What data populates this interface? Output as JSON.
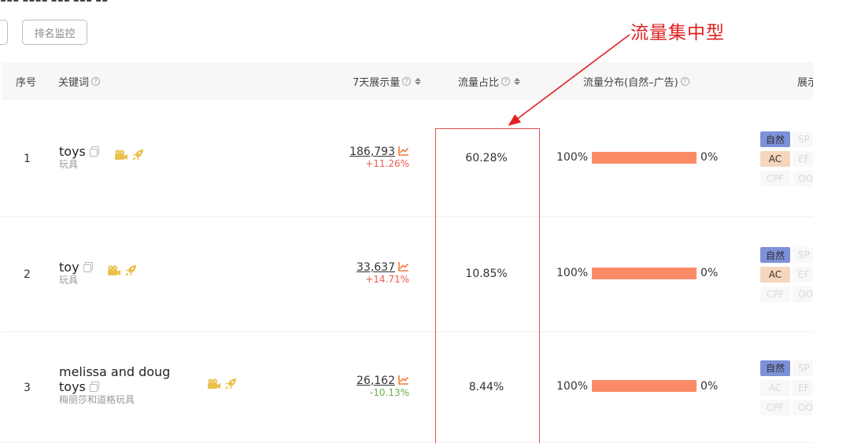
{
  "toolbar": {
    "rank_monitor_label": "排名监控"
  },
  "table": {
    "headers": {
      "index": "序号",
      "keyword": "关键词",
      "impressions_7d": "7天展示量",
      "traffic_share": "流量占比",
      "traffic_distribution": "流量分布(自然–广告)",
      "display": "展示"
    },
    "rows": [
      {
        "index": "1",
        "keyword_line1": "toys",
        "keyword_line2": "",
        "keyword_cn": "玩具",
        "impressions": "186,793",
        "change": "+11.26%",
        "change_dir": "up",
        "share": "60.28%",
        "natural_pct": "100%",
        "ad_pct": "0%",
        "natural_fraction": 1.0,
        "tags": [
          {
            "label": "自然",
            "state": "blue"
          },
          {
            "label": "SP",
            "state": "off"
          },
          {
            "label": "AC",
            "state": "orange"
          },
          {
            "label": "EF",
            "state": "off"
          },
          {
            "label": "CPF",
            "state": "off"
          },
          {
            "label": "OO",
            "state": "off"
          }
        ]
      },
      {
        "index": "2",
        "keyword_line1": "toy",
        "keyword_line2": "",
        "keyword_cn": "玩具",
        "impressions": "33,637",
        "change": "+14.71%",
        "change_dir": "up",
        "share": "10.85%",
        "natural_pct": "100%",
        "ad_pct": "0%",
        "natural_fraction": 1.0,
        "tags": [
          {
            "label": "自然",
            "state": "blue"
          },
          {
            "label": "SP",
            "state": "off"
          },
          {
            "label": "AC",
            "state": "orange"
          },
          {
            "label": "EF",
            "state": "off"
          },
          {
            "label": "CPF",
            "state": "off"
          },
          {
            "label": "OO",
            "state": "off"
          }
        ]
      },
      {
        "index": "3",
        "keyword_line1": "melissa and doug",
        "keyword_line2": "toys",
        "keyword_cn": "梅丽莎和道格玩具",
        "impressions": "26,162",
        "change": "-10.13%",
        "change_dir": "down",
        "share": "8.44%",
        "natural_pct": "100%",
        "ad_pct": "0%",
        "natural_fraction": 1.0,
        "tags": [
          {
            "label": "自然",
            "state": "blue"
          },
          {
            "label": "SP",
            "state": "off"
          },
          {
            "label": "AC",
            "state": "off"
          },
          {
            "label": "EF",
            "state": "off"
          },
          {
            "label": "CPF",
            "state": "off"
          },
          {
            "label": "OO",
            "state": "off"
          }
        ]
      }
    ]
  },
  "annotation": {
    "label": "流量集中型",
    "color": "#e02020"
  },
  "colors": {
    "bar_natural": "#fb8b66",
    "tag_blue": "#7e91d8",
    "tag_orange": "#f6d6bd",
    "positive": "#ee5a4f",
    "negative": "#6aaf4a",
    "icon_gold": "#e9c04a"
  }
}
